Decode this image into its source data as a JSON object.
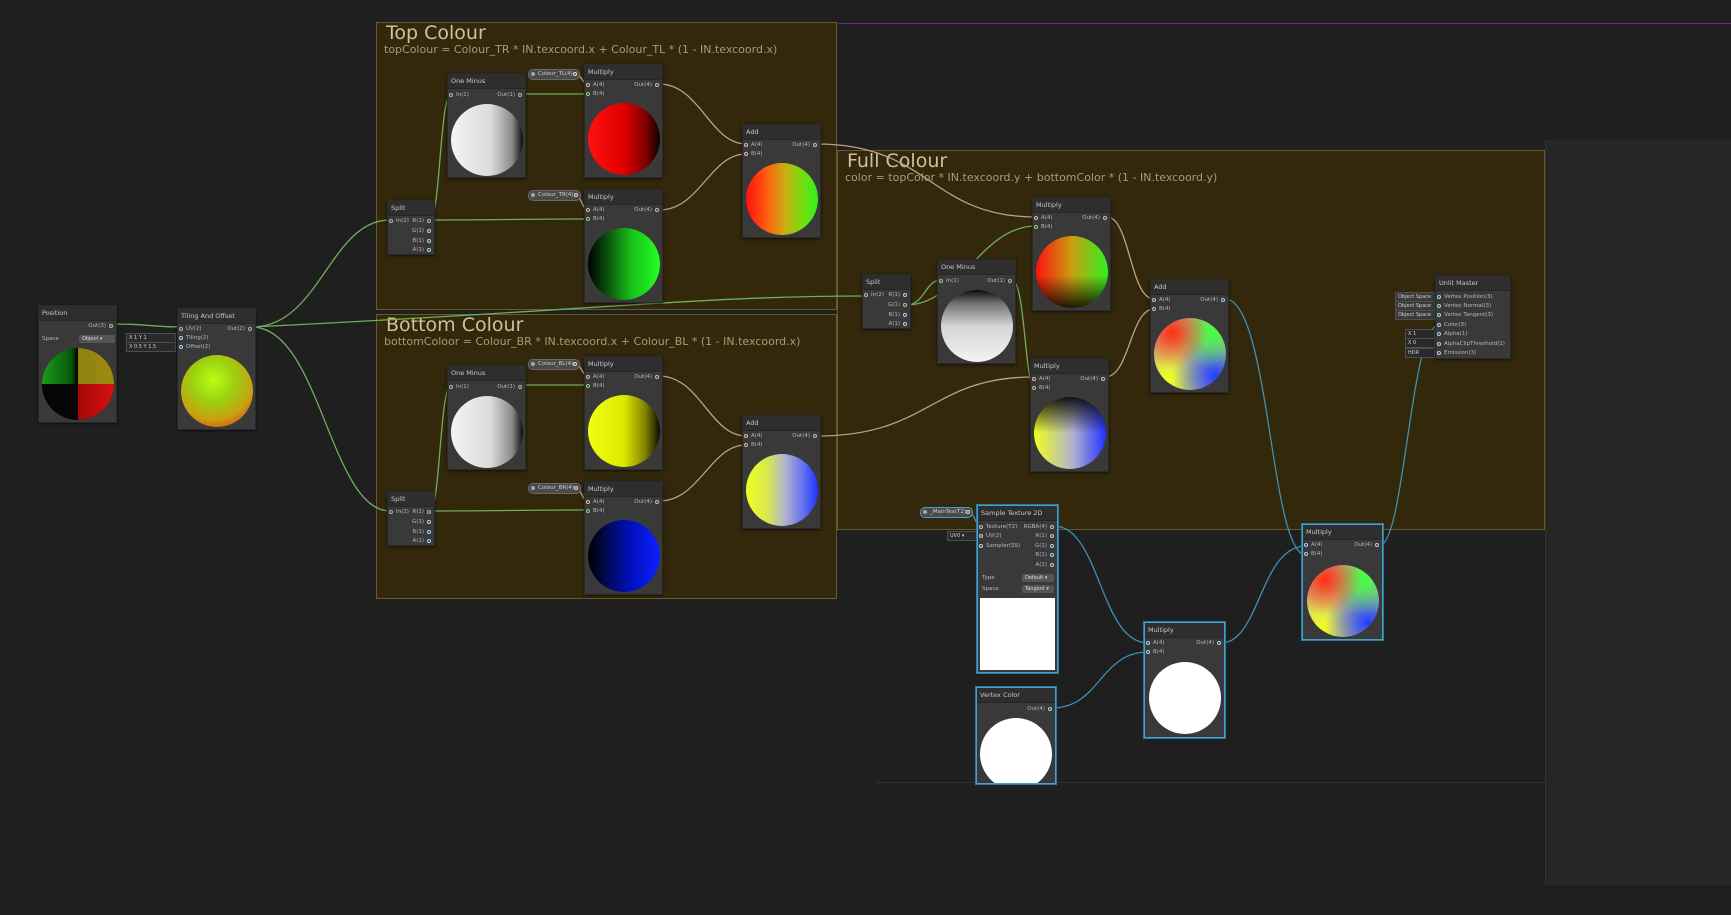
{
  "groups": {
    "top": {
      "title": "Top Colour",
      "subtitle": "topColour = Colour_TR * IN.texcoord.x + Colour_TL  * (1 - IN.texcoord.x)"
    },
    "bottom": {
      "title": "Bottom Colour",
      "subtitle": "bottomColoor = Colour_BR * IN.texcoord.x + Colour_BL * (1 - IN.texcoord.x)"
    },
    "full": {
      "title": "Full Colour",
      "subtitle": "color = topColor * IN.texcoord.y + bottomColor * (1 - IN.texcoord.y)"
    }
  },
  "nodes": {
    "position": {
      "title": "Position",
      "out": "Out(3)",
      "space_label": "Space",
      "space_value": "Object"
    },
    "tiling": {
      "title": "Tiling And Offset",
      "in_uv": "UV(2)",
      "in_tiling": "Tiling(2)",
      "in_offset": "Offset(2)",
      "out": "Out(2)"
    },
    "tiling_fields": {
      "x1": "X",
      "v1": "1",
      "y1": "Y",
      "v2": "1",
      "x2": "X",
      "v3": "0.5",
      "y2": "Y",
      "v4": "1.5"
    },
    "split_top": {
      "title": "Split",
      "in": "In(2)",
      "r": "R(1)",
      "g": "G(1)",
      "b": "B(1)",
      "a": "A(1)"
    },
    "split_bottom": {
      "title": "Split",
      "in": "In(2)",
      "r": "R(1)",
      "g": "G(1)",
      "b": "B(1)",
      "a": "A(1)"
    },
    "split_full": {
      "title": "Split",
      "in": "In(2)",
      "r": "R(1)",
      "g": "G(1)",
      "b": "B(1)",
      "a": "A(1)"
    },
    "oneminus_top": {
      "title": "One Minus",
      "in": "In(1)",
      "out": "Out(1)"
    },
    "oneminus_bottom": {
      "title": "One Minus",
      "in": "In(1)",
      "out": "Out(1)"
    },
    "oneminus_full": {
      "title": "One Minus",
      "in": "In(1)",
      "out": "Out(1)"
    },
    "mul_tl": {
      "title": "Multiply",
      "a": "A(4)",
      "b": "B(4)",
      "out": "Out(4)"
    },
    "mul_tr": {
      "title": "Multiply",
      "a": "A(4)",
      "b": "B(4)",
      "out": "Out(4)"
    },
    "mul_bl": {
      "title": "Multiply",
      "a": "A(4)",
      "b": "B(4)",
      "out": "Out(4)"
    },
    "mul_br": {
      "title": "Multiply",
      "a": "A(4)",
      "b": "B(4)",
      "out": "Out(4)"
    },
    "add_top": {
      "title": "Add",
      "a": "A(4)",
      "b": "B(4)",
      "out": "Out(4)"
    },
    "add_bottom": {
      "title": "Add",
      "a": "A(4)",
      "b": "B(4)",
      "out": "Out(4)"
    },
    "mul_full_top": {
      "title": "Multiply",
      "a": "A(4)",
      "b": "B(4)",
      "out": "Out(4)"
    },
    "mul_full_bottom": {
      "title": "Multiply",
      "a": "A(4)",
      "b": "B(4)",
      "out": "Out(4)"
    },
    "add_full": {
      "title": "Add",
      "a": "A(4)",
      "b": "B(4)",
      "out": "Out(4)"
    },
    "sample_tex": {
      "title": "Sample Texture 2D",
      "texture": "Texture(T2)",
      "uv": "UV(2)",
      "sampler": "Sampler(SS)",
      "rgba": "RGBA(4)",
      "r": "R(1)",
      "g": "G(1)",
      "b": "B(1)",
      "a": "A(1)",
      "type_label": "Type",
      "type_value": "Default",
      "space_label": "Space",
      "space_value": "Tangent",
      "uv_field": "UV0"
    },
    "vertex_color": {
      "title": "Vertex Color",
      "out": "Out(4)"
    },
    "mul_tex_vc": {
      "title": "Multiply",
      "a": "A(4)",
      "b": "B(4)",
      "out": "Out(4)"
    },
    "mul_final": {
      "title": "Multiply",
      "a": "A(4)",
      "b": "B(4)",
      "out": "Out(4)"
    },
    "unlit_master": {
      "title": "Unlit Master",
      "ports": [
        "Vertex Position(3)",
        "Vertex Normal(3)",
        "Vertex Tangent(3)",
        "Color(3)",
        "Alpha(1)",
        "AlphaClipThreshold(1)",
        "Emission(3)"
      ],
      "space_fields": [
        "Object Space",
        "Object Space",
        "Object Space"
      ],
      "alpha_field": "1",
      "clip_field": "0",
      "emission_field": "HDR",
      "x_label": "X"
    }
  },
  "props": {
    "tl": "Colour_TL(4)",
    "tr": "Colour_TR(4)",
    "bl": "Colour_BL(4)",
    "br": "Colour_BR(4)",
    "maintex": "_MainTex(T2)"
  },
  "colors": {
    "group_bg": "#33280c",
    "wire_green": "#6fae5c",
    "wire_tan": "#bfa08a",
    "wire_blue": "#3e8fb8",
    "selected": "#44a0d0"
  }
}
